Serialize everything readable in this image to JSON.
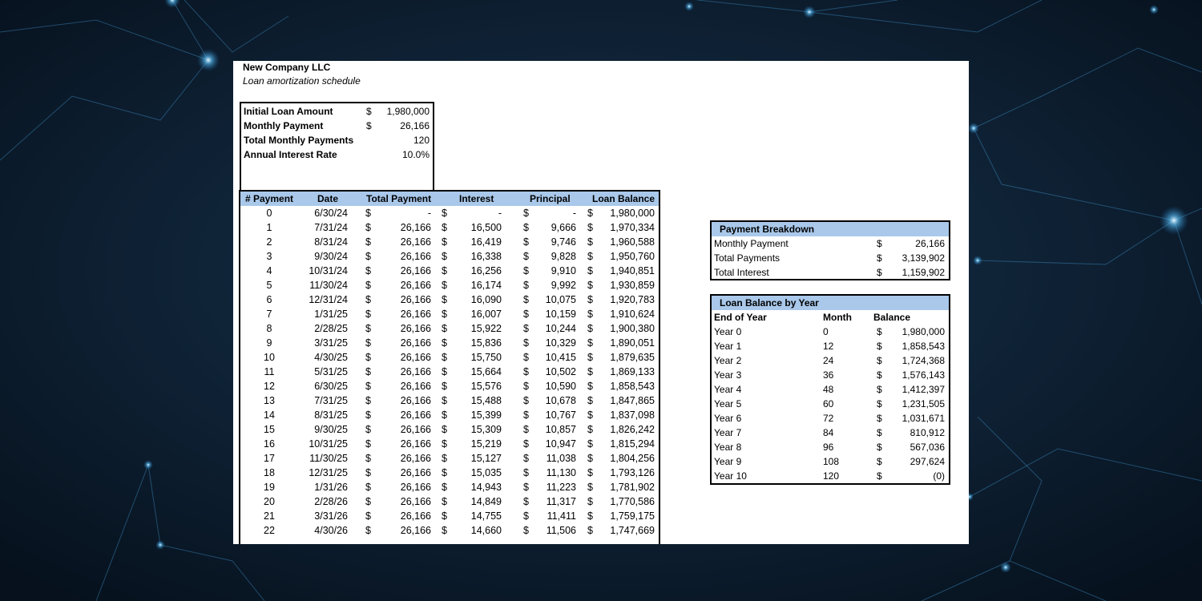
{
  "colors": {
    "header_fill": "#a9c8ea",
    "background": "#0b1a2a",
    "sheet": "#ffffff"
  },
  "company": "New Company LLC",
  "subtitle": "Loan amortization schedule",
  "summary": [
    {
      "label": "Initial Loan Amount",
      "currency": "$",
      "value": "1,980,000"
    },
    {
      "label": "Monthly Payment",
      "currency": "$",
      "value": "26,166"
    },
    {
      "label": "Total Monthly Payments",
      "currency": "",
      "value": "120"
    },
    {
      "label": "Annual Interest Rate",
      "currency": "",
      "value": "10.0%"
    }
  ],
  "schedule": {
    "headers": [
      "# Payment",
      "Date",
      "Total Payment",
      "Interest",
      "Principal",
      "Loan Balance"
    ],
    "currency": "$",
    "rows": [
      [
        "0",
        "6/30/24",
        "-",
        "-",
        "-",
        "1,980,000"
      ],
      [
        "1",
        "7/31/24",
        "26,166",
        "16,500",
        "9,666",
        "1,970,334"
      ],
      [
        "2",
        "8/31/24",
        "26,166",
        "16,419",
        "9,746",
        "1,960,588"
      ],
      [
        "3",
        "9/30/24",
        "26,166",
        "16,338",
        "9,828",
        "1,950,760"
      ],
      [
        "4",
        "10/31/24",
        "26,166",
        "16,256",
        "9,910",
        "1,940,851"
      ],
      [
        "5",
        "11/30/24",
        "26,166",
        "16,174",
        "9,992",
        "1,930,859"
      ],
      [
        "6",
        "12/31/24",
        "26,166",
        "16,090",
        "10,075",
        "1,920,783"
      ],
      [
        "7",
        "1/31/25",
        "26,166",
        "16,007",
        "10,159",
        "1,910,624"
      ],
      [
        "8",
        "2/28/25",
        "26,166",
        "15,922",
        "10,244",
        "1,900,380"
      ],
      [
        "9",
        "3/31/25",
        "26,166",
        "15,836",
        "10,329",
        "1,890,051"
      ],
      [
        "10",
        "4/30/25",
        "26,166",
        "15,750",
        "10,415",
        "1,879,635"
      ],
      [
        "11",
        "5/31/25",
        "26,166",
        "15,664",
        "10,502",
        "1,869,133"
      ],
      [
        "12",
        "6/30/25",
        "26,166",
        "15,576",
        "10,590",
        "1,858,543"
      ],
      [
        "13",
        "7/31/25",
        "26,166",
        "15,488",
        "10,678",
        "1,847,865"
      ],
      [
        "14",
        "8/31/25",
        "26,166",
        "15,399",
        "10,767",
        "1,837,098"
      ],
      [
        "15",
        "9/30/25",
        "26,166",
        "15,309",
        "10,857",
        "1,826,242"
      ],
      [
        "16",
        "10/31/25",
        "26,166",
        "15,219",
        "10,947",
        "1,815,294"
      ],
      [
        "17",
        "11/30/25",
        "26,166",
        "15,127",
        "11,038",
        "1,804,256"
      ],
      [
        "18",
        "12/31/25",
        "26,166",
        "15,035",
        "11,130",
        "1,793,126"
      ],
      [
        "19",
        "1/31/26",
        "26,166",
        "14,943",
        "11,223",
        "1,781,902"
      ],
      [
        "20",
        "2/28/26",
        "26,166",
        "14,849",
        "11,317",
        "1,770,586"
      ],
      [
        "21",
        "3/31/26",
        "26,166",
        "14,755",
        "11,411",
        "1,759,175"
      ],
      [
        "22",
        "4/30/26",
        "26,166",
        "14,660",
        "11,506",
        "1,747,669"
      ]
    ]
  },
  "payment_breakdown": {
    "title": "Payment Breakdown",
    "rows": [
      {
        "label": "Monthly Payment",
        "currency": "$",
        "value": "26,166"
      },
      {
        "label": "Total Payments",
        "currency": "$",
        "value": "3,139,902"
      },
      {
        "label": "Total Interest",
        "currency": "$",
        "value": "1,159,902"
      }
    ]
  },
  "balance_by_year": {
    "title": "Loan Balance by Year",
    "headers": [
      "End of Year",
      "Month",
      "Balance"
    ],
    "currency": "$",
    "rows": [
      [
        "Year 0",
        "0",
        "1,980,000"
      ],
      [
        "Year 1",
        "12",
        "1,858,543"
      ],
      [
        "Year 2",
        "24",
        "1,724,368"
      ],
      [
        "Year 3",
        "36",
        "1,576,143"
      ],
      [
        "Year 4",
        "48",
        "1,412,397"
      ],
      [
        "Year 5",
        "60",
        "1,231,505"
      ],
      [
        "Year 6",
        "72",
        "1,031,671"
      ],
      [
        "Year 7",
        "84",
        "810,912"
      ],
      [
        "Year 8",
        "96",
        "567,036"
      ],
      [
        "Year 9",
        "108",
        "297,624"
      ],
      [
        "Year 10",
        "120",
        "(0)"
      ]
    ]
  }
}
